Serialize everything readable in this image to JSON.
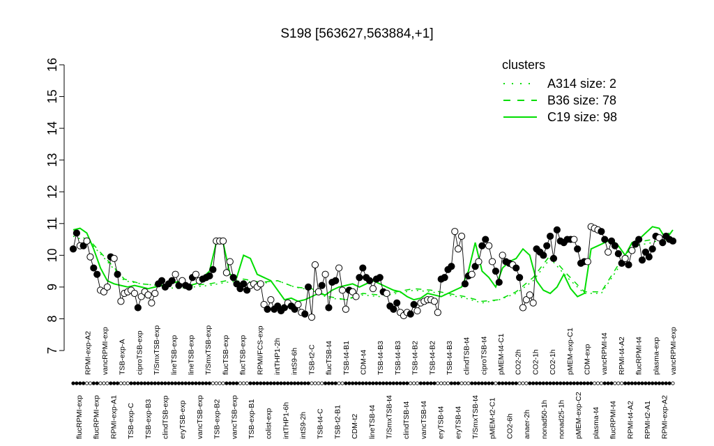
{
  "chart_data": {
    "type": "line",
    "title": "S198 [563627,563884,+1]",
    "xlabel": "",
    "ylabel": "",
    "ylim": [
      7,
      16
    ],
    "yticks": [
      7,
      8,
      9,
      10,
      11,
      12,
      13,
      14,
      15,
      16
    ],
    "grid": false,
    "legend": {
      "title": "clusters",
      "position": "top-right",
      "color": "#00dd00",
      "entries": [
        {
          "label": "A314 size: 2",
          "style": "dotted"
        },
        {
          "label": "B36 size: 78",
          "style": "dashed"
        },
        {
          "label": "C19 size: 98",
          "style": "solid"
        }
      ]
    },
    "x_labels": [
      "flucRPMI-exp",
      "RPMI-exp-A2",
      "flucRPMI-exp",
      "vancRPMI-exp",
      "RPMI-exp-A1",
      "TSB-exp-A",
      "TSB-exp-C",
      "ciproTSB-exp",
      "TSB-exp-B3",
      "T/SmxTSB-exp",
      "clindTSB-exp",
      "lineTSB-exp",
      "eryTSB-exp",
      "lineTSB-exp",
      "vancTSB-exp",
      "T/SmxTSB-exp",
      "TSB-exp-B2",
      "flucTSB-exp",
      "vancTSB-exp",
      "flucTSB-exp",
      "TSB-exp-B1",
      "RPMI/FCS-exp",
      "colist-exp",
      "intTHP1-2h",
      "intTHP1-6h",
      "intS9-6h",
      "intS9-2h",
      "TSB-t2-C",
      "TSB-t4-C",
      "flucTSB-t4",
      "TSB-t2-B1",
      "TSB-t4-B1",
      "CDM-t2",
      "CDM-t4",
      "lineTSB-t4",
      "TSB-t4-B3",
      "T/SmxTSB-t4",
      "TSB-t4-B3",
      "clindTSB-t4",
      "TSB-t4-B2",
      "vancTSB-t4",
      "TSB-t4-B2",
      "eryTSB-t4",
      "TSB-t4-B3",
      "eryTSB-t4",
      "clindTSB-t4",
      "T/SmxTSB-t4",
      "ciproTSB-t4",
      "pMEM-t2-C1",
      "pMEM-t4-C1",
      "CO2-6h",
      "CO2-2h",
      "anaer-2h",
      "CO2-1h",
      "nonad50-1h",
      "CO2-1h",
      "nonad25-1h",
      "pMEM-exp-C1",
      "pMEM-exp-C2",
      "CDM-exp",
      "plasma-t4",
      "vancRPMI-t4",
      "flucRPMI-t4",
      "RPMI-t4-A2",
      "RPMI-t4-A2",
      "flucRPMI-t4",
      "RPMI-t2-A1",
      "plasma-exp",
      "RPMI-exp-A2",
      "vancRPMI-exp"
    ],
    "series": [
      {
        "style": "dotted",
        "x": [
          0,
          5,
          10,
          15,
          20,
          25,
          30,
          35,
          40,
          45,
          50,
          55,
          60,
          65,
          70,
          75,
          80,
          85,
          90,
          95,
          100,
          105,
          110,
          115,
          120,
          125,
          130,
          135,
          140,
          145,
          150,
          155,
          160,
          165,
          170,
          175
        ],
        "values": [
          10.6,
          10.4,
          9.8,
          9.2,
          9.1,
          9.05,
          8.95,
          9.0,
          9.05,
          9.15,
          9.2,
          9.1,
          9.2,
          9.0,
          8.9,
          8.65,
          8.6,
          8.75,
          8.7,
          8.8,
          8.9,
          8.85,
          8.75,
          8.65,
          8.5,
          8.6,
          8.8,
          9.2,
          9.9,
          9.3,
          8.8,
          8.8,
          9.6,
          10.3,
          10.4,
          10.6
        ]
      },
      {
        "style": "dashed",
        "x": [
          0,
          5,
          10,
          15,
          20,
          25,
          30,
          35,
          40,
          45,
          50,
          55,
          60,
          65,
          70,
          75,
          80,
          85,
          90,
          95,
          100,
          105,
          110,
          115,
          120,
          125,
          130,
          135,
          140,
          145,
          150,
          155,
          160,
          165,
          170,
          175
        ],
        "values": [
          10.7,
          10.45,
          9.85,
          9.25,
          9.1,
          9.05,
          9.0,
          9.05,
          9.1,
          9.2,
          9.25,
          9.15,
          9.2,
          9.0,
          8.95,
          8.7,
          8.6,
          8.8,
          8.75,
          8.85,
          8.95,
          8.9,
          8.8,
          8.7,
          8.55,
          8.6,
          8.85,
          9.3,
          10.0,
          9.4,
          8.85,
          8.85,
          9.7,
          10.4,
          10.5,
          10.7
        ]
      },
      {
        "style": "solid",
        "x": [
          0,
          2,
          4,
          6,
          8,
          10,
          12,
          14,
          16,
          18,
          20,
          22,
          24,
          26,
          28,
          30,
          32,
          34,
          36,
          38,
          40,
          42,
          44,
          46,
          48,
          50,
          52,
          54,
          56,
          58,
          60,
          62,
          64,
          66,
          68,
          70,
          72,
          74,
          76,
          78,
          80,
          82,
          84,
          86,
          88,
          90,
          92,
          94,
          96,
          98,
          100,
          102,
          104,
          106,
          108,
          110,
          112,
          114,
          116,
          118,
          120,
          122,
          124,
          126,
          128,
          130,
          132,
          134,
          136,
          138,
          140,
          142,
          144,
          146,
          148,
          150,
          152,
          154,
          156,
          158,
          160,
          162,
          164,
          166,
          168,
          170,
          172,
          174,
          176
        ],
        "values": [
          10.8,
          10.85,
          10.7,
          10.2,
          9.6,
          9.2,
          9.1,
          9.05,
          9.0,
          9.05,
          9.0,
          8.95,
          9.0,
          9.05,
          9.1,
          9.15,
          9.2,
          9.05,
          9.1,
          9.3,
          9.5,
          10.4,
          10.4,
          9.4,
          9.3,
          10.0,
          9.9,
          9.4,
          9.3,
          9.2,
          8.9,
          8.6,
          8.65,
          8.55,
          8.6,
          8.7,
          8.8,
          8.75,
          8.9,
          9.0,
          9.05,
          9.1,
          9.0,
          9.1,
          9.2,
          9.1,
          9.0,
          8.9,
          8.85,
          8.7,
          8.6,
          8.65,
          8.8,
          8.75,
          8.7,
          8.8,
          8.9,
          9.0,
          9.5,
          10.4,
          9.5,
          9.3,
          9.0,
          9.6,
          9.8,
          9.9,
          10.2,
          10.0,
          9.2,
          8.9,
          8.8,
          9.0,
          9.4,
          8.95,
          8.7,
          8.8,
          10.2,
          10.3,
          10.4,
          10.5,
          10.3,
          10.0,
          10.4,
          10.5,
          10.7,
          10.9,
          10.85,
          10.5,
          10.8
        ]
      }
    ],
    "points": {
      "x": [
        0,
        1,
        2,
        3,
        4,
        5,
        6,
        7,
        8,
        9,
        10,
        11,
        12,
        13,
        14,
        15,
        16,
        17,
        18,
        19,
        20,
        21,
        22,
        23,
        24,
        25,
        26,
        27,
        28,
        29,
        30,
        31,
        32,
        33,
        34,
        35,
        36,
        37,
        38,
        39,
        40,
        41,
        42,
        43,
        44,
        45,
        46,
        47,
        48,
        49,
        50,
        51,
        52,
        53,
        54,
        55,
        56,
        57,
        58,
        59,
        60,
        61,
        62,
        63,
        64,
        65,
        66,
        67,
        68,
        69,
        70,
        71,
        72,
        73,
        74,
        75,
        76,
        77,
        78,
        79,
        80,
        81,
        82,
        83,
        84,
        85,
        86,
        87,
        88,
        89,
        90,
        91,
        92,
        93,
        94,
        95,
        96,
        97,
        98,
        99,
        100,
        101,
        102,
        103,
        104,
        105,
        106,
        107,
        108,
        109,
        110,
        111,
        112,
        113,
        114,
        115,
        116,
        117,
        118,
        119,
        120,
        121,
        122,
        123,
        124,
        125,
        126,
        127,
        128,
        129,
        130,
        131,
        132,
        133,
        134,
        135,
        136,
        137,
        138,
        139,
        140,
        141,
        142,
        143,
        144,
        145,
        146,
        147,
        148,
        149,
        150,
        151,
        152,
        153,
        154,
        155,
        156,
        157,
        158,
        159,
        160,
        161,
        162,
        163,
        164,
        165,
        166,
        167,
        168,
        169,
        170,
        171,
        172,
        173,
        174,
        175,
        176
      ],
      "values": [
        10.2,
        10.7,
        10.3,
        10.3,
        10.45,
        9.95,
        9.6,
        9.4,
        8.9,
        8.85,
        9.0,
        9.95,
        9.9,
        9.4,
        8.55,
        8.8,
        8.85,
        8.9,
        8.8,
        8.35,
        8.7,
        8.85,
        8.75,
        8.5,
        8.8,
        9.1,
        9.2,
        9.0,
        9.1,
        9.2,
        9.4,
        9.05,
        9.2,
        9.05,
        9.0,
        9.3,
        9.4,
        9.2,
        9.25,
        9.3,
        9.35,
        9.55,
        10.45,
        10.45,
        10.45,
        9.45,
        9.8,
        9.3,
        9.1,
        8.95,
        9.1,
        8.9,
        9.05,
        9.1,
        9.0,
        9.1,
        8.45,
        8.3,
        8.6,
        8.3,
        8.4,
        8.25,
        8.35,
        8.5,
        8.4,
        8.3,
        8.45,
        8.2,
        8.15,
        9.0,
        8.05,
        9.7,
        8.85,
        9.05,
        9.4,
        8.35,
        9.15,
        9.2,
        9.6,
        8.9,
        8.3,
        8.9,
        8.85,
        8.7,
        9.3,
        9.6,
        9.3,
        9.2,
        8.95,
        9.25,
        9.3,
        8.85,
        8.8,
        8.4,
        8.3,
        8.5,
        8.2,
        8.1,
        8.2,
        8.15,
        8.45,
        8.25,
        8.5,
        8.55,
        8.6,
        8.6,
        8.55,
        8.2,
        9.25,
        9.3,
        9.55,
        9.65,
        10.75,
        10.2,
        10.6,
        9.1,
        9.35,
        9.4,
        9.65,
        9.8,
        10.3,
        10.5,
        10.3,
        9.8,
        9.5,
        9.15,
        10.0,
        9.8,
        9.75,
        9.7,
        9.6,
        9.3,
        8.35,
        8.6,
        8.75,
        8.5,
        10.2,
        10.1,
        10.0,
        10.3,
        10.6,
        9.9,
        10.8,
        10.45,
        10.4,
        10.5,
        10.5,
        10.5,
        10.2,
        9.75,
        9.8,
        9.8,
        10.9,
        10.85,
        10.8,
        10.75,
        10.5,
        10.1,
        10.45,
        10.3,
        10.05,
        9.75,
        9.9,
        9.7,
        10.15,
        10.35,
        10.5,
        9.85,
        10.1,
        9.95,
        10.2,
        10.6,
        10.55,
        10.4,
        10.6,
        10.5,
        10.45,
        10.5,
        10.1
      ],
      "filled": [
        true,
        true,
        false,
        true,
        false,
        false,
        true,
        true,
        false,
        false,
        false,
        true,
        false,
        true,
        false,
        false,
        false,
        false,
        false,
        true,
        false,
        false,
        false,
        false,
        false,
        true,
        true,
        true,
        true,
        true,
        false,
        true,
        false,
        true,
        true,
        true,
        false,
        false,
        true,
        true,
        true,
        true,
        false,
        false,
        false,
        false,
        false,
        true,
        true,
        true,
        true,
        true,
        false,
        false,
        false,
        false,
        false,
        true,
        false,
        true,
        true,
        true,
        true,
        false,
        true,
        true,
        false,
        false,
        true,
        true,
        false,
        false,
        false,
        true,
        false,
        true,
        true,
        true,
        false,
        false,
        false,
        true,
        false,
        false,
        true,
        true,
        true,
        true,
        false,
        true,
        true,
        true,
        false,
        true,
        true,
        true,
        false,
        false,
        false,
        true,
        true,
        false,
        false,
        false,
        false,
        false,
        false,
        false,
        true,
        true,
        true,
        true,
        false,
        false,
        false,
        true,
        true,
        false,
        true,
        false,
        true,
        true,
        false,
        false,
        true,
        true,
        false,
        true,
        true,
        false,
        true,
        true,
        false,
        false,
        false,
        false,
        true,
        true,
        true,
        true,
        true,
        true,
        true,
        true,
        true,
        true,
        true,
        false,
        true,
        true,
        true,
        false,
        false,
        false,
        false,
        true,
        true,
        false,
        true,
        true,
        true,
        true,
        false,
        true,
        false,
        true,
        true,
        true,
        true,
        true,
        true,
        true,
        false,
        true,
        true,
        true,
        true,
        false
      ]
    },
    "rug": {
      "x": [
        0,
        1,
        2,
        3,
        4,
        5,
        6,
        7,
        8,
        9,
        10,
        11,
        12,
        13,
        14,
        15,
        16,
        17,
        18,
        19,
        20,
        21,
        22,
        23,
        24,
        25,
        26,
        27,
        28,
        29,
        30,
        31,
        32,
        33,
        34,
        35,
        36,
        37,
        38,
        39,
        40,
        41,
        42,
        43,
        44,
        45,
        46,
        47,
        48,
        49,
        50,
        51,
        52,
        53,
        54,
        55,
        56,
        57,
        58,
        59,
        60,
        61,
        62,
        63,
        64,
        65,
        66,
        67,
        68,
        69,
        70,
        71,
        72,
        73,
        74,
        75,
        76,
        77,
        78,
        79,
        80,
        81,
        82,
        83,
        84,
        85,
        86,
        87,
        88,
        89,
        90,
        91,
        92,
        93,
        94,
        95,
        96,
        97,
        98,
        99,
        100,
        101,
        102,
        103,
        104,
        105,
        106,
        107,
        108,
        109,
        110,
        111,
        112,
        113,
        114,
        115,
        116,
        117,
        118,
        119,
        120,
        121,
        122,
        123,
        124,
        125,
        126,
        127,
        128,
        129,
        130,
        131,
        132,
        133,
        134,
        135,
        136,
        137,
        138,
        139,
        140,
        141,
        142,
        143,
        144,
        145,
        146,
        147,
        148,
        149,
        150,
        151,
        152,
        153,
        154,
        155,
        156,
        157,
        158,
        159,
        160,
        161,
        162,
        163,
        164,
        165,
        166,
        167,
        168,
        169,
        170,
        171,
        172,
        173,
        174,
        175,
        176
      ],
      "filled": [
        true,
        true,
        true,
        true,
        false,
        false,
        true,
        true,
        false,
        false,
        false,
        true,
        true,
        true,
        false,
        false,
        false,
        true,
        true,
        true,
        true,
        true,
        true,
        true,
        true,
        true,
        true,
        true,
        true,
        true,
        true,
        true,
        true,
        true,
        true,
        true,
        true,
        true,
        true,
        true,
        true,
        false,
        false,
        false,
        false,
        true,
        true,
        true,
        true,
        false,
        false,
        false,
        true,
        true,
        true,
        true,
        true,
        true,
        true,
        true,
        true,
        true,
        true,
        true,
        true,
        true,
        true,
        true,
        true,
        true,
        false,
        false,
        false,
        false,
        true,
        true,
        true,
        true,
        false,
        false,
        true,
        true,
        true,
        true,
        true,
        true,
        true,
        true,
        true,
        true,
        true,
        true,
        true,
        true,
        true,
        true,
        true,
        true,
        true,
        false,
        false,
        false,
        true,
        true,
        true,
        true,
        true,
        false,
        false,
        false,
        false,
        true,
        true,
        true,
        false,
        false,
        false,
        true,
        true,
        true,
        true,
        true,
        true,
        true,
        false,
        true,
        true,
        true,
        true,
        true,
        true,
        false,
        false,
        false,
        true,
        true,
        true,
        true,
        true,
        true,
        true,
        true,
        true,
        true,
        true,
        true,
        true,
        true,
        true,
        true,
        true,
        true,
        true,
        false,
        false,
        false,
        true,
        true,
        true,
        false,
        false,
        false,
        true,
        true,
        true,
        true,
        true,
        true,
        true,
        true,
        true,
        true,
        true,
        true,
        true,
        true,
        false
      ]
    }
  }
}
